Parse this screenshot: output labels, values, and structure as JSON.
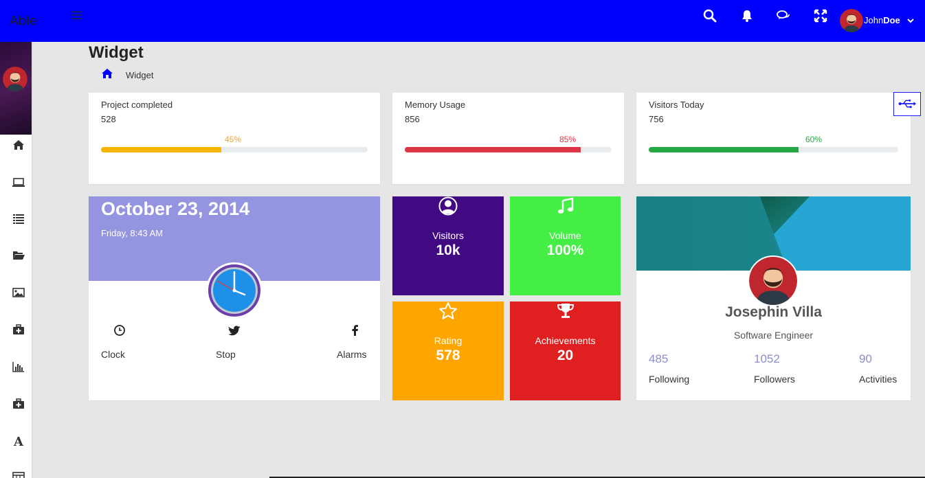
{
  "app": {
    "brand": "Able"
  },
  "header": {
    "user": {
      "first": "John",
      "last": "Doe"
    },
    "icons": [
      "search-icon",
      "bell-icon",
      "chat-icon",
      "fullscreen-icon",
      "chevron-down-icon"
    ],
    "color": "#0000ff"
  },
  "sidebar": {
    "icons": [
      "home-icon",
      "laptop-icon",
      "list-icon",
      "folder-open-icon",
      "image-icon",
      "medkit-icon",
      "bar-chart-icon",
      "medkit-icon",
      "font-icon",
      "table-icon"
    ]
  },
  "page": {
    "title": "Widget",
    "breadcrumb": {
      "current": "Widget"
    }
  },
  "stats": [
    {
      "label": "Project completed",
      "value": "528",
      "percent": 45,
      "percent_label": "45%",
      "color": "#f7b400"
    },
    {
      "label": "Memory Usage",
      "value": "856",
      "percent": 85,
      "percent_label": "85%",
      "color": "#dc3545"
    },
    {
      "label": "Visitors Today",
      "value": "756",
      "percent": 60,
      "percent_label": "60%",
      "color": "#28a745"
    }
  ],
  "date_card": {
    "date": "October 23, 2014",
    "day_time": "Friday, 8:43 AM",
    "actions": [
      {
        "label": "Clock",
        "icon": "clock-icon"
      },
      {
        "label": "Stop",
        "icon": "twitter-icon"
      },
      {
        "label": "Alarms",
        "icon": "facebook-icon"
      }
    ]
  },
  "tiles": [
    {
      "label": "Visitors",
      "value": "10k",
      "icon": "user-circle-icon",
      "color": "#410a82"
    },
    {
      "label": "Volume",
      "value": "100%",
      "icon": "music-icon",
      "color": "#44ee44"
    },
    {
      "label": "Rating",
      "value": "578",
      "icon": "star-icon",
      "color": "#ffa500"
    },
    {
      "label": "Achievements",
      "value": "20",
      "icon": "trophy-icon",
      "color": "#e02020"
    }
  ],
  "profile": {
    "name": "Josephin Villa",
    "role": "Software Engineer",
    "stats": [
      {
        "value": "485",
        "label": "Following"
      },
      {
        "value": "1052",
        "label": "Followers"
      },
      {
        "value": "90",
        "label": "Activities"
      }
    ]
  }
}
